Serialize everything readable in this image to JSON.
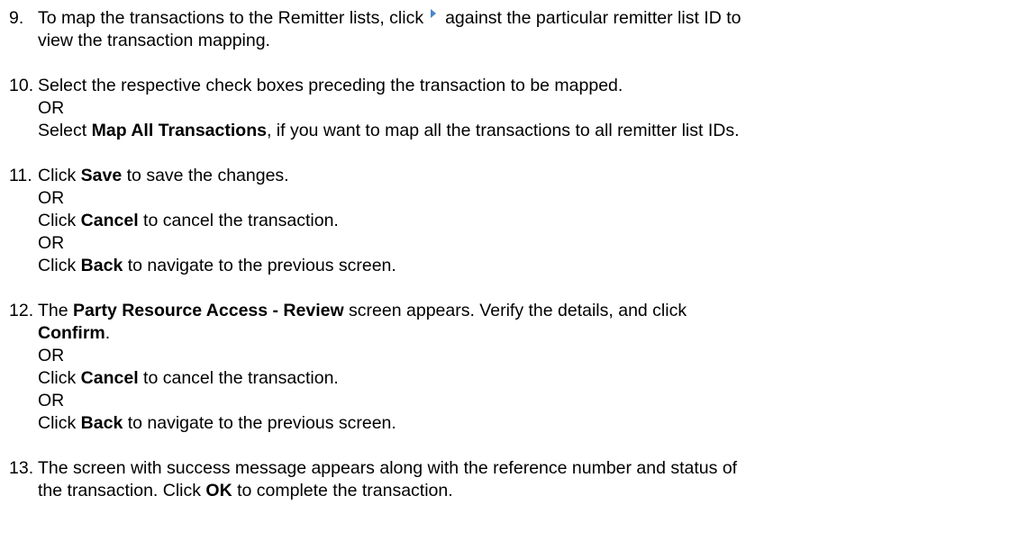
{
  "steps": [
    {
      "number": "9.",
      "line1_a": "To map the transactions to the Remitter lists, click",
      "icon": "blue-right-arrow-icon",
      "line1_b": "against the particular remitter list ID to",
      "line2": "view the transaction mapping."
    },
    {
      "number": "10.",
      "line1": "Select the respective check boxes preceding the transaction to be mapped.",
      "or1": "OR",
      "line3_pre": "Select ",
      "line3_bold": "Map All Transactions",
      "line3_post": ", if you want to map all the transactions to all remitter list IDs."
    },
    {
      "number": "11.",
      "a_pre": "Click ",
      "a_bold": "Save",
      "a_post": " to save the changes.",
      "or1": "OR",
      "b_pre": "Click ",
      "b_bold": "Cancel",
      "b_post": " to cancel the transaction.",
      "or2": "OR",
      "c_pre": "Click ",
      "c_bold": "Back",
      "c_post": " to navigate to the previous screen."
    },
    {
      "number": "12.",
      "a_pre": "The ",
      "a_bold": "Party Resource Access - Review",
      "a_post": " screen appears. Verify the details, and click",
      "a2_bold": "Confirm",
      "a2_post": ".",
      "or1": "OR",
      "b_pre": "Click ",
      "b_bold": "Cancel",
      "b_post": " to cancel the transaction.",
      "or2": "OR",
      "c_pre": "Click ",
      "c_bold": "Back",
      "c_post": " to navigate to the previous screen."
    },
    {
      "number": "13.",
      "line1": "The screen with success message appears along with the reference number and status of",
      "line2_pre": "the transaction. Click ",
      "line2_bold": "OK",
      "line2_post": " to complete the transaction."
    }
  ]
}
